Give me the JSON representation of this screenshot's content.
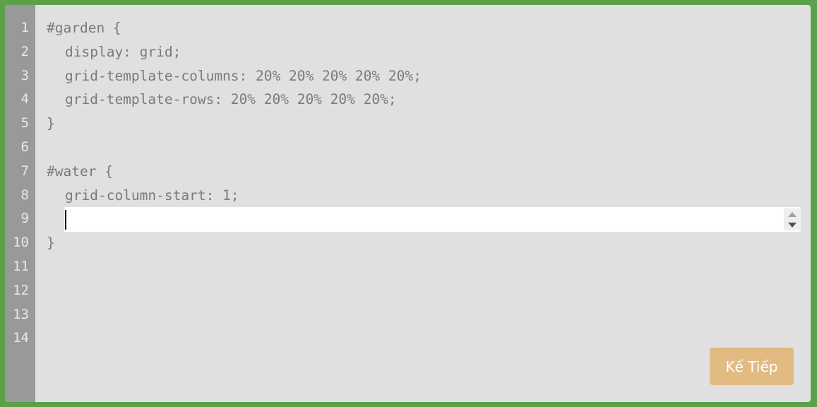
{
  "editor": {
    "line_numbers": [
      "1",
      "2",
      "3",
      "4",
      "5",
      "6",
      "7",
      "8",
      "9",
      "10",
      "11",
      "12",
      "13",
      "14"
    ],
    "lines": {
      "l1": "#garden {",
      "l2": "display: grid;",
      "l3": "grid-template-columns: 20% 20% 20% 20% 20%;",
      "l4": "grid-template-rows: 20% 20% 20% 20% 20%;",
      "l5": "}",
      "l6": "",
      "l7": "#water {",
      "l8": "grid-column-start: 1;",
      "l10": "}"
    },
    "input_value": ""
  },
  "next_button_label": "Kế Tiếp",
  "colors": {
    "background": "#5aa14a",
    "editor_bg": "#e0e0e0",
    "gutter_bg": "#999999",
    "button_bg": "#e2bb83"
  }
}
